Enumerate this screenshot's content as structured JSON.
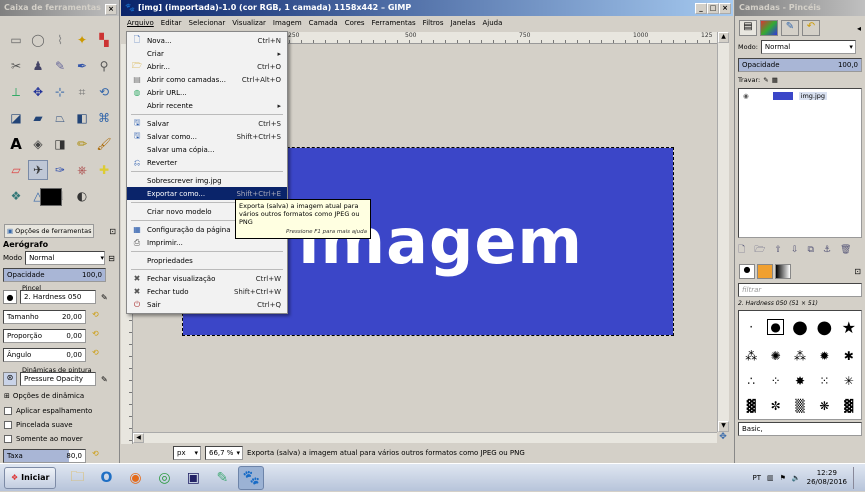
{
  "toolbox": {
    "title": "Caixa de ferramentas",
    "options_tab": "Opções de ferramentas",
    "tool_name": "Aerógrafo",
    "mode_label": "Modo",
    "mode_value": "Normal",
    "opacity_label": "Opacidade",
    "opacity_value": "100,0",
    "brush_label": "Pincel",
    "brush_value": "2. Hardness 050",
    "size_label": "Tamanho",
    "size_value": "20,00",
    "ratio_label": "Proporção",
    "ratio_value": "0,00",
    "angle_label": "Ângulo",
    "angle_value": "0,00",
    "dynamics_label": "Dinâmicas de pintura",
    "dynamics_value": "Pressure Opacity",
    "dynamics_options": "Opções de dinâmica",
    "apply_jitter": "Aplicar espalhamento",
    "smooth_stroke": "Pincelada suave",
    "motion_only": "Somente ao mover",
    "rate_label": "Taxa",
    "rate_value": "80,0"
  },
  "main": {
    "title": "[img] (importada)-1.0 (cor RGB, 1 camada) 1158x442 – GIMP",
    "menubar": [
      "Arquivo",
      "Editar",
      "Selecionar",
      "Visualizar",
      "Imagem",
      "Camada",
      "Cores",
      "Ferramentas",
      "Filtros",
      "Janelas",
      "Ajuda"
    ],
    "ruler_ticks": [
      "250",
      "500",
      "750",
      "1000",
      "125"
    ],
    "canvas_text": "imagem",
    "canvas_color": "#3b46c8",
    "unit": "px",
    "zoom": "66,7 %",
    "status": "Exporta (salva) a imagem atual para vários outros formatos como JPEG ou PNG"
  },
  "file_menu": {
    "items": [
      {
        "label": "Nova...",
        "shortcut": "Ctrl+N",
        "icon": "new-icon"
      },
      {
        "label": "Criar",
        "shortcut": "▸",
        "icon": ""
      },
      {
        "label": "Abrir...",
        "shortcut": "Ctrl+O",
        "icon": "open-icon"
      },
      {
        "label": "Abrir como camadas...",
        "shortcut": "Ctrl+Alt+O",
        "icon": "open-layers-icon"
      },
      {
        "label": "Abrir URL...",
        "shortcut": "",
        "icon": "globe-icon"
      },
      {
        "label": "Abrir recente",
        "shortcut": "▸",
        "icon": ""
      },
      {
        "label": "Salvar",
        "shortcut": "Ctrl+S",
        "icon": "save-icon"
      },
      {
        "label": "Salvar como...",
        "shortcut": "Shift+Ctrl+S",
        "icon": "save-as-icon"
      },
      {
        "label": "Salvar uma cópia...",
        "shortcut": "",
        "icon": ""
      },
      {
        "label": "Reverter",
        "shortcut": "",
        "icon": "revert-icon"
      },
      {
        "label": "Sobrescrever img.jpg",
        "shortcut": "",
        "icon": ""
      },
      {
        "label": "Exportar como...",
        "shortcut": "Shift+Ctrl+E",
        "icon": ""
      },
      {
        "label": "Criar novo modelo",
        "shortcut": "",
        "icon": ""
      },
      {
        "label": "Configuração da página",
        "shortcut": "",
        "icon": "page-setup-icon"
      },
      {
        "label": "Imprimir...",
        "shortcut": "",
        "icon": "print-icon"
      },
      {
        "label": "Propriedades",
        "shortcut": "",
        "icon": ""
      },
      {
        "label": "Fechar visualização",
        "shortcut": "Ctrl+W",
        "icon": "close-icon"
      },
      {
        "label": "Fechar tudo",
        "shortcut": "Shift+Ctrl+W",
        "icon": "close-all-icon"
      },
      {
        "label": "Sair",
        "shortcut": "Ctrl+Q",
        "icon": "quit-icon"
      }
    ]
  },
  "tooltip": {
    "text": "Exporta (salva) a imagem atual para vários outros formatos como JPEG ou PNG",
    "hint": "Pressione F1 para mais ajuda"
  },
  "layers": {
    "title": "Camadas - Pincéis",
    "mode_label": "Modo:",
    "mode_value": "Normal",
    "opacity_label": "Opacidade",
    "opacity_value": "100,0",
    "lock_label": "Travar:",
    "layer_name": "img.jpg",
    "filter_placeholder": "filtrar",
    "brush_name": "2. Hardness 050 (51 × 51)",
    "brush_bottom": "Basic,"
  },
  "taskbar": {
    "start": "Iniciar",
    "lang": "PT",
    "time": "12:29",
    "date": "26/08/2016"
  }
}
